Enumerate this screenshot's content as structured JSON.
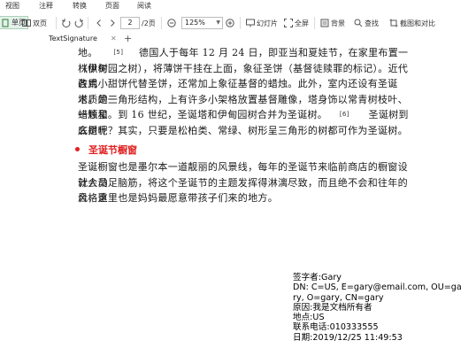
{
  "menu": {
    "items": [
      "视图",
      "注释",
      "转换",
      "页面",
      "阅读"
    ]
  },
  "toolbar": {
    "single_page": "单页",
    "double_page": "双页",
    "page_current": "2",
    "page_total": "/2页",
    "zoom": "125%",
    "slideshow": "幻灯片",
    "fullscreen": "全屏",
    "background": "背景",
    "find": "查找",
    "screenshot_compare": "截图和对比"
  },
  "tab": {
    "title": "TextSignature"
  },
  "document": {
    "para1_line1_a": "地。",
    "para1_mark": "[5]",
    "para1_line1_b": "德国人于每年 12 月 24 日，即亚当和夏娃节，在家里布置一株枞树",
    "para1_lines": [
      "（伊甸园之树），将薄饼干挂在上面，象征圣饼（基督徒赎罪的标记）。近代改用",
      "各式小甜饼代替圣饼，还常加上象征基督的蜡烛。此外，室内还设有圣诞塔，是一",
      "木质的三角形结构，上有许多小架格放置基督雕像，塔身饰以常青树枝叶、蜡烛和"
    ],
    "para1_line5_a": "一颗星。到 16 世纪，圣诞塔和伊甸园树合并为圣诞树。",
    "para1_mark2": "[6]",
    "para1_line5_b": "圣诞树到底是什",
    "para1_line6": "么树呢？其实，只要是松柏类、常绿、树形呈三角形的树都可作为圣诞树。",
    "heading": "圣诞节橱窗",
    "para2_lines": [
      "圣诞橱窗也是墨尔本一道靓丽的风景线，每年的圣诞节来临前商店的橱窗设计人员",
      "就会动足脑筋，将这个圣诞节的主题发挥得淋漓尽致，而且绝不会和往年的风格重",
      "合，这里也是妈妈最愿意带孩子们来的地方。"
    ]
  },
  "signature": {
    "signer": "签字者:Gary",
    "dn_line1": "DN: C=US, E=gary@email.com, OU=ga",
    "dn_line2": "ry, O=gary, CN=gary",
    "reason": "原因:我是文档所有者",
    "location": "地点:US",
    "phone": "联系电话:010333555",
    "date": "日期:2019/12/25 11:49:53"
  },
  "colors": {
    "accent": "#2e7d32",
    "heading": "#e02020"
  }
}
